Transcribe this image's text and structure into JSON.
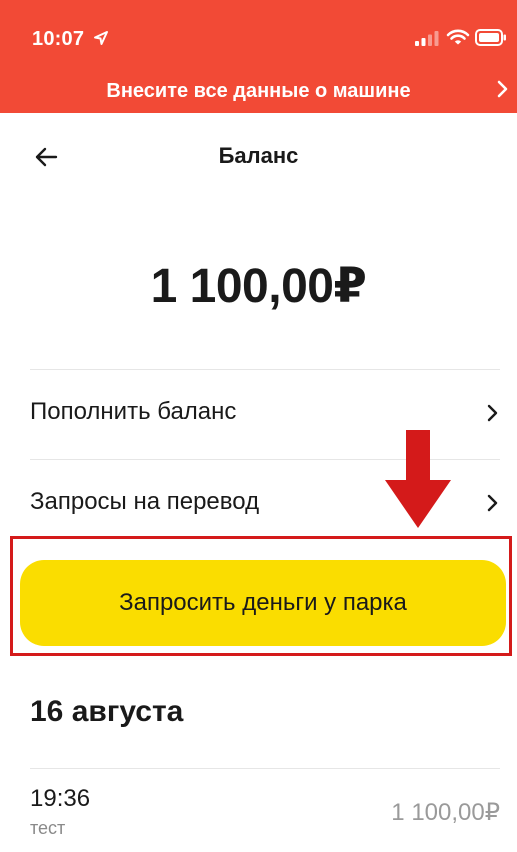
{
  "status_bar": {
    "time": "10:07"
  },
  "banner": {
    "text": "Внесите все данные о машине"
  },
  "header": {
    "title": "Баланс"
  },
  "balance": {
    "amount": "1 100,00₽"
  },
  "menu": {
    "items": [
      {
        "label": "Пополнить баланс"
      },
      {
        "label": "Запросы на перевод"
      }
    ]
  },
  "actions": {
    "request_money_label": "Запросить деньги у парка"
  },
  "history": {
    "date": "16 августа",
    "transactions": [
      {
        "time": "19:36",
        "description": "тест",
        "amount": "1 100,00₽"
      }
    ]
  },
  "colors": {
    "banner_red": "#f24a36",
    "button_yellow": "#fadd00",
    "annotation_red": "#d41a1a"
  },
  "icons": {
    "back": "arrow-left-icon",
    "chevron": "chevron-right-icon",
    "location": "location-arrow-icon",
    "signal": "signal-icon",
    "wifi": "wifi-icon",
    "battery": "battery-icon"
  }
}
